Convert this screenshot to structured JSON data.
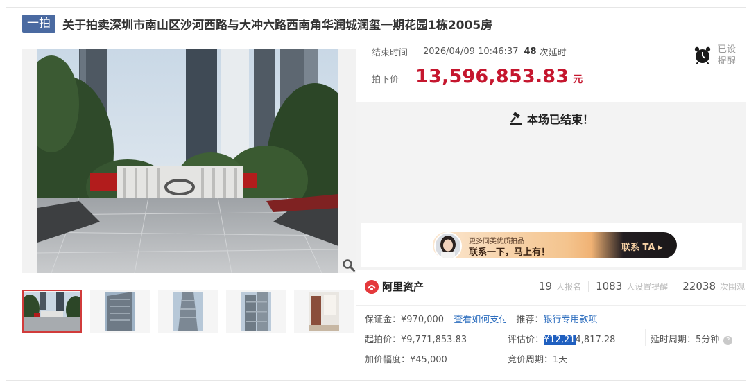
{
  "header": {
    "badge": "一拍",
    "title": "关于拍卖深圳市南山区沙河西路与大冲六路西南角华润城润玺一期花园1栋2005房"
  },
  "auction": {
    "end_time_label": "结束时间",
    "end_time": "2026/04/09 10:46:37",
    "delay_count": "48",
    "delay_label": "次延时",
    "final_price_label": "拍下价",
    "final_price": "13,596,853.83",
    "currency_unit": "元",
    "reminder_label_1": "已设",
    "reminder_label_2": "提醒",
    "status_text": "本场已结束！"
  },
  "promo": {
    "sub_text": "更多同类优质拍品",
    "main_text": "联系一下，马上有！",
    "cta": "联系 TA ▸"
  },
  "platform": {
    "name": "阿里资产",
    "stats": [
      {
        "num": "19",
        "label": "人报名"
      },
      {
        "num": "1083",
        "label": "人设置提醒"
      },
      {
        "num": "22038",
        "label": "次围观"
      }
    ]
  },
  "details": {
    "deposit_label": "保证金：",
    "deposit_value": "¥970,000",
    "pay_link": "查看如何支付",
    "recommend_label": "推荐：",
    "recommend_link": "银行专用款项",
    "start_price_label": "起拍价：",
    "start_price_value": "¥9,771,853.83",
    "appraisal_label": "评估价：",
    "appraisal_highlight": "¥12,21",
    "appraisal_rest": "4,817.28",
    "delay_period_label": "延时周期：",
    "delay_period_value": "5分钟",
    "increment_label": "加价幅度：",
    "increment_value": "¥45,000",
    "bid_period_label": "竞价周期：",
    "bid_period_value": "1天"
  },
  "icons": {
    "zoom": "magnifier-icon",
    "clock": "alarm-clock-icon",
    "gavel": "gavel-icon",
    "help": "question-icon"
  },
  "colors": {
    "accent_red": "#c5162e",
    "badge_blue": "#4a6aa1",
    "link_blue": "#2f6fbf",
    "thumb_active": "#d13b3b"
  }
}
